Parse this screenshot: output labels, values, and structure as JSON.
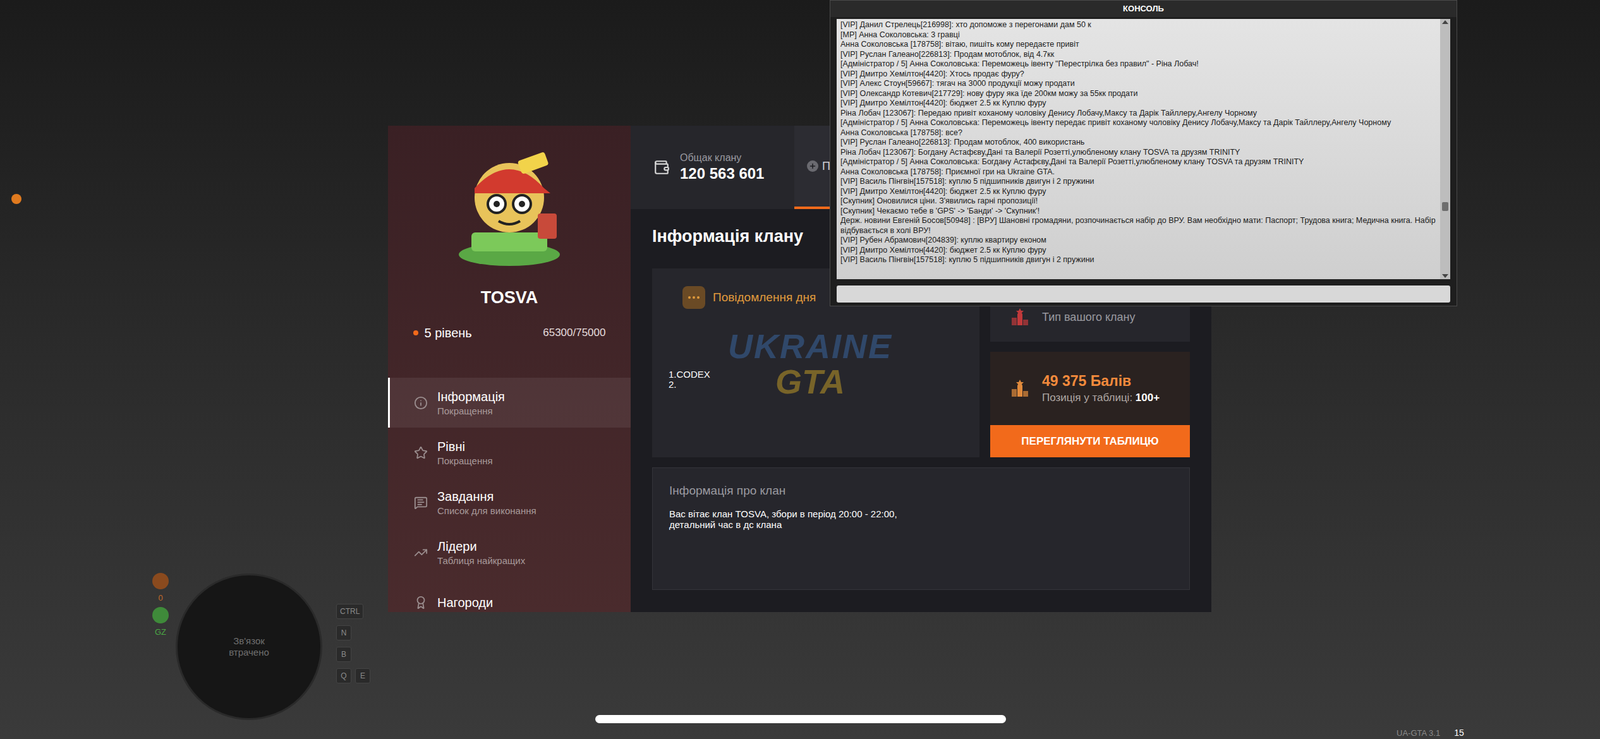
{
  "console": {
    "title": "КОНСОЛЬ",
    "lines": [
      "[VIP] Данил Стрелець[216998]: хто допоможе з перегонами дам 50 к",
      "[MP] Анна Соколовська: 3 гравці",
      "Анна Соколовська [178758]: вітаю, пишіть кому передаєте привіт",
      "[VIP] Руслан Галеано[226813]: Продам мотоблок, від 4.7кк",
      "[Адміністратор / 5] Анна Соколовська: Переможець івенту \"Перестрілка без правил\" - Ріна Лобач!",
      "[VIP] Дмитро Хемілтон[4420]: Хтось продає фуру?",
      "[VIP] Алекс Стоун[59667]: тягач на 3000 продукції можу продати",
      "[VIP] Олександр Котевич[217729]: нову фуру яка їде 200км можу за 55кк продати",
      "[VIP] Дмитро Хемілтон[4420]: бюджет 2.5 кк Куплю фуру",
      "Ріна Лобач [123067]: Передаю привіт коханому чоловіку Денису Лобачу,Максу та Дарік Тайллеру,Ангелу Чорному",
      "[Адміністратор / 5] Анна Соколовська: Переможець івенту передає привіт коханому чоловіку Денису Лобачу,Максу та Дарік Тайллеру,Ангелу Чорному",
      "Анна Соколовська [178758]: все?",
      "[VIP] Руслан Галеано[226813]: Продам мотоблок, 400 використань",
      "Ріна Лобач [123067]: Богдану Астафєву,Дані та Валерії Розетті,улюбленому клану TOSVA та друзям TRINITY",
      "[Адміністратор / 5] Анна Соколовська: Богдану Астафєву,Дані та Валерії Розетті,улюбленому клану TOSVA та друзям TRINITY",
      "Анна Соколовська [178758]: Приємної гри на Ukraine GTA.",
      "[VIP] Василь Пінгвін[157518]: куплю 5 підшипників двигун і 2 пружини",
      "[VIP] Дмитро Хемілтон[4420]: бюджет 2.5 кк Куплю фуру",
      "[Скупник] Оновилися ціни. З'явились гарні пропозиції!",
      "[Скупник] Чекаємо тебе в 'GPS' -> 'Банди' -> 'Скупник'!",
      "Держ. новини Евгеній Босов[50948] : [ВРУ] Шановні громадяни, розпочинається набір до ВРУ. Вам необхідно мати: Паспорт; Трудова книга; Медична книга. Набір відбувається в холі ВРУ!",
      "[VIP] Рубен Абрамович[204839]: куплю квартиру економ",
      "[VIP] Дмитро Хемілтон[4420]: бюджет 2.5 кк Куплю фуру",
      "[VIP] Василь Пінгвін[157518]: куплю 5 підшипників двигун і 2 пружини"
    ]
  },
  "clan": {
    "name": "TOSVA",
    "level": "5 рівень",
    "xp": "65300/75000",
    "xp_level": 0.87,
    "menu": [
      {
        "title": "Інформація",
        "subtitle": "Покращення",
        "selected": true
      },
      {
        "title": "Рівні",
        "subtitle": "Покращення",
        "selected": false
      },
      {
        "title": "Завдання",
        "subtitle": "Список для виконання",
        "selected": false
      },
      {
        "title": "Лідери",
        "subtitle": "Таблиця найкращих",
        "selected": false
      },
      {
        "title": "Нагороди",
        "subtitle": "",
        "selected": false
      }
    ],
    "treasury": {
      "label": "Общак клану",
      "value": "120 563 601"
    },
    "tabs": [
      {
        "label": "П",
        "selected": true
      }
    ],
    "title": "Інформація клану",
    "motd": {
      "title": "Повідомлення дня",
      "lines": [
        "1.CODEX",
        "2."
      ]
    },
    "watermark": {
      "top": "UKRAINE",
      "bottom": "GTA"
    },
    "clan_type": {
      "label": "Тип вашого клану"
    },
    "points": {
      "value": "49 375 Балів",
      "position_label": "Позиція у таблиці:",
      "position": "100+"
    },
    "button": "ПЕРЕГЛЯНУТИ ТАБЛИЦЮ",
    "about": {
      "title": "Інформація про клан",
      "lines": [
        "Вас вітає клан TOSVA, збори в період 20:00 - 22:00,",
        "детальний час в дс клана"
      ]
    }
  },
  "hud": {
    "minimap": [
      "Зв'язок",
      "втрачено"
    ],
    "stats": [
      "0",
      "GZ"
    ],
    "keys": [
      [
        "CTRL"
      ],
      [
        "N"
      ],
      [
        "B"
      ],
      [
        "Q",
        "E"
      ]
    ],
    "version": "UA-GTA 3.1",
    "fps": "15"
  }
}
